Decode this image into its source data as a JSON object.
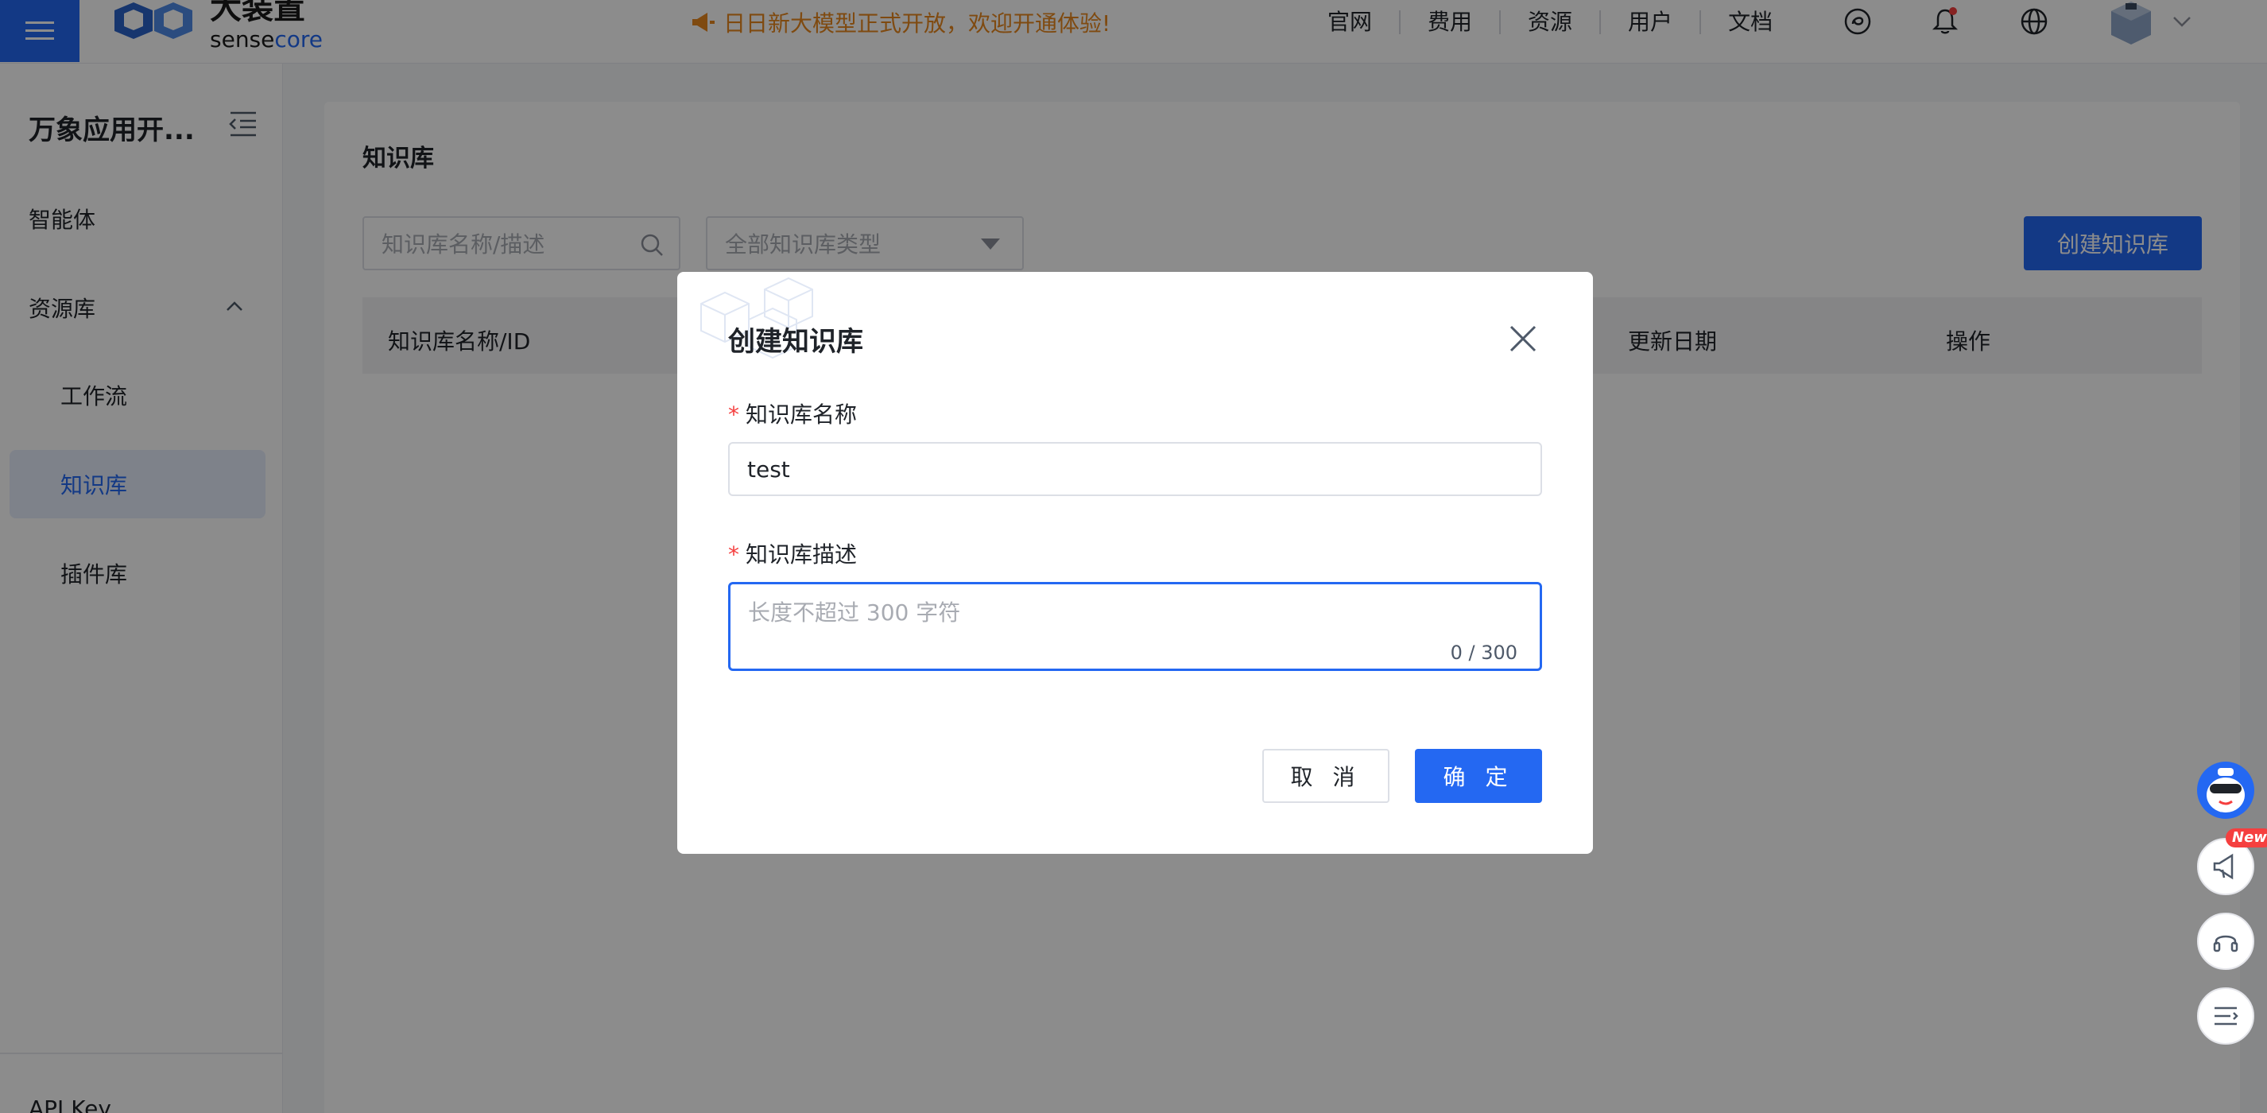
{
  "topbar": {
    "logo_cn": "大装置",
    "logo_en_prefix": "sense",
    "logo_en_suffix": "core",
    "announcement": "日日新大模型正式开放，欢迎开通体验!",
    "nav": [
      "官网",
      "费用",
      "资源",
      "用户",
      "文档"
    ]
  },
  "sidebar": {
    "title": "万象应用开...",
    "items": [
      {
        "label": "智能体"
      },
      {
        "label": "资源库"
      },
      {
        "label": "工作流"
      },
      {
        "label": "知识库"
      },
      {
        "label": "插件库"
      }
    ],
    "bottom_item": "API Key"
  },
  "content": {
    "title": "知识库",
    "search_placeholder": "知识库名称/描述",
    "type_placeholder": "全部知识库类型",
    "create_label": "创建知识库",
    "columns": [
      "知识库名称/ID",
      "更新日期",
      "操作"
    ]
  },
  "modal": {
    "title": "创建知识库",
    "name_label": "知识库名称",
    "name_value": "test",
    "desc_label": "知识库描述",
    "desc_placeholder": "长度不超过 300 字符",
    "desc_count": "0 / 300",
    "cancel_label": "取 消",
    "ok_label": "确 定"
  },
  "floating": {
    "new_badge": "New"
  },
  "colors": {
    "accent": "#2468f2",
    "announcement": "#e8871e",
    "required": "#f53f3f"
  },
  "icons": [
    "menu-icon",
    "megaphone-icon",
    "chatgpt-icon",
    "bell-icon",
    "globe-icon",
    "collapse-icon",
    "chevron-up-icon",
    "search-icon",
    "caret-down-icon",
    "close-icon",
    "robot-icon",
    "announce-icon",
    "headset-icon",
    "list-icon"
  ]
}
